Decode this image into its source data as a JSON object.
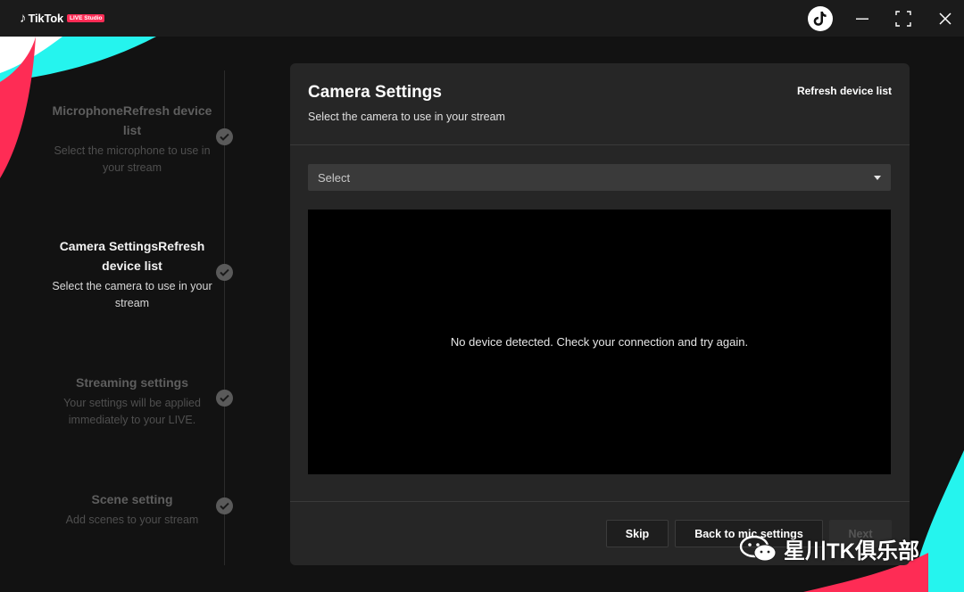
{
  "app": {
    "name": "TikTok",
    "badge": "LIVE Studio"
  },
  "window_controls": [
    "minimize",
    "maximize",
    "close"
  ],
  "stepper": {
    "steps": [
      {
        "title": "MicrophoneRefresh device list",
        "desc": "Select the microphone to use in your stream",
        "state": "inactive"
      },
      {
        "title": "Camera SettingsRefresh device list",
        "desc": "Select the camera to use in your stream",
        "state": "active"
      },
      {
        "title": "Streaming settings",
        "desc": "Your settings will be applied immediately to your LIVE.",
        "state": "inactive"
      },
      {
        "title": "Scene setting",
        "desc": "Add scenes to your stream",
        "state": "inactive"
      }
    ]
  },
  "panel": {
    "title": "Camera Settings",
    "subtitle": "Select the camera to use in your stream",
    "refresh_label": "Refresh device list",
    "select_value": "Select",
    "preview_message": "No device detected. Check your connection and try again.",
    "buttons": {
      "skip": "Skip",
      "back": "Back to mic settings",
      "next": "Next"
    }
  },
  "watermark": "星川TK俱乐部",
  "colors": {
    "accent_red": "#fe2c55",
    "accent_cyan": "#25f4ee",
    "background": "#121212",
    "panel": "#262626"
  }
}
